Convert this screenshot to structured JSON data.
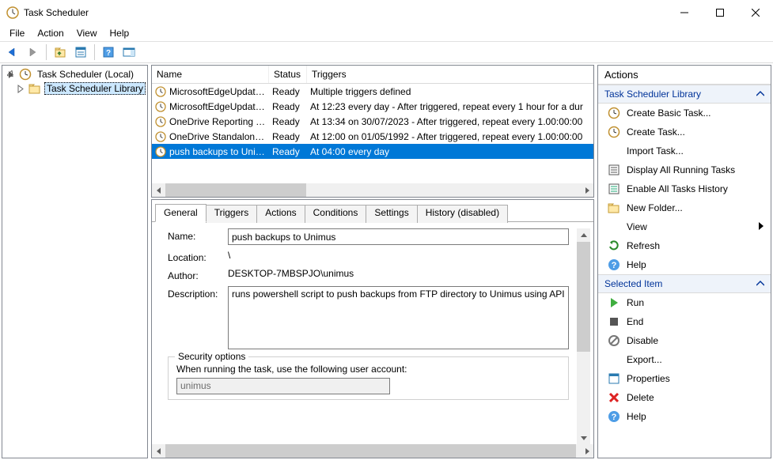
{
  "window": {
    "title": "Task Scheduler"
  },
  "menu": {
    "file": "File",
    "action": "Action",
    "view": "View",
    "help": "Help"
  },
  "tree": {
    "root": "Task Scheduler (Local)",
    "library": "Task Scheduler Library"
  },
  "list": {
    "headers": {
      "name": "Name",
      "status": "Status",
      "triggers": "Triggers"
    },
    "rows": [
      {
        "name": "MicrosoftEdgeUpdateT...",
        "status": "Ready",
        "trigger": "Multiple triggers defined"
      },
      {
        "name": "MicrosoftEdgeUpdateT...",
        "status": "Ready",
        "trigger": "At 12:23 every day - After triggered, repeat every 1 hour for a dur"
      },
      {
        "name": "OneDrive Reporting Tas...",
        "status": "Ready",
        "trigger": "At 13:34 on 30/07/2023 - After triggered, repeat every 1.00:00:00"
      },
      {
        "name": "OneDrive Standalone U...",
        "status": "Ready",
        "trigger": "At 12:00 on 01/05/1992 - After triggered, repeat every 1.00:00:00"
      },
      {
        "name": "push backups to Unimus",
        "status": "Ready",
        "trigger": "At 04:00 every day"
      }
    ]
  },
  "tabs": {
    "general": "General",
    "triggers": "Triggers",
    "actions": "Actions",
    "conditions": "Conditions",
    "settings": "Settings",
    "history": "History (disabled)"
  },
  "general": {
    "labels": {
      "name": "Name:",
      "location": "Location:",
      "author": "Author:",
      "description": "Description:"
    },
    "name": "push backups to Unimus",
    "location": "\\",
    "author": "DESKTOP-7MBSPJO\\unimus",
    "description": "runs powershell script to push backups from FTP directory to Unimus using API",
    "security_options": "Security options",
    "run_as_label": "When running the task, use the following user account:",
    "run_as_user": "unimus"
  },
  "actions": {
    "title": "Actions",
    "section_library": "Task Scheduler Library",
    "section_selected": "Selected Item",
    "library_items": {
      "create_basic": "Create Basic Task...",
      "create_task": "Create Task...",
      "import": "Import Task...",
      "display_running": "Display All Running Tasks",
      "enable_history": "Enable All Tasks History",
      "new_folder": "New Folder...",
      "view": "View",
      "refresh": "Refresh",
      "help": "Help"
    },
    "selected_items": {
      "run": "Run",
      "end": "End",
      "disable": "Disable",
      "export": "Export...",
      "properties": "Properties",
      "delete": "Delete",
      "help2": "Help"
    }
  }
}
